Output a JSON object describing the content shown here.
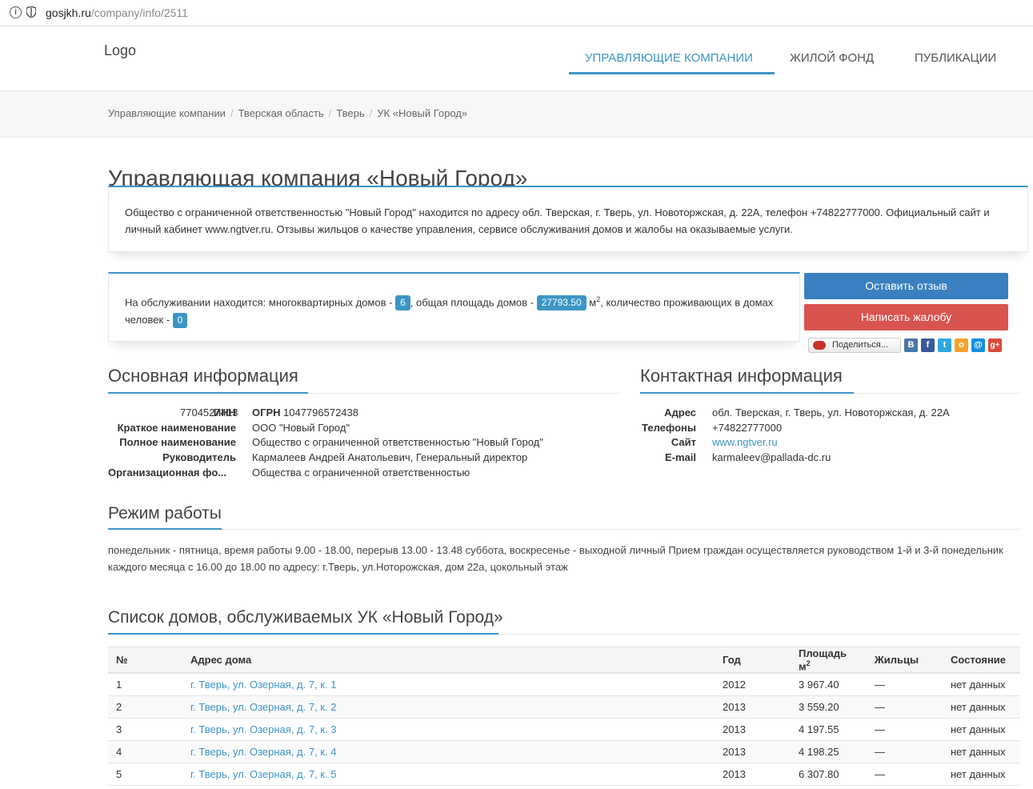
{
  "browser": {
    "url_host": "gosjkh.ru",
    "url_path": "/company/info/2511"
  },
  "header": {
    "logo": "Logo",
    "nav": [
      "УПРАВЛЯЮЩИЕ КОМПАНИИ",
      "ЖИЛОЙ ФОНД",
      "ПУБЛИКАЦИИ"
    ],
    "active_nav": 0
  },
  "breadcrumb": [
    "Управляющие компании",
    "Тверская область",
    "Тверь",
    "УК «Новый Город»"
  ],
  "page_title": "Управляющая компания «Новый Город»",
  "intro": "Общество с ограниченной ответственностью \"Новый Город\" находится по адресу обл. Тверская, г. Тверь, ул. Новоторжская, д. 22А, телефон +74822777000. Официальный сайт и личный кабинет www.ngtver.ru. Отзывы жильцов о качестве управления, сервисе обслуживания домов и жалобы на оказываемые услуги.",
  "stats": {
    "text_1": "На обслуживании находится: многоквартирных домов - ",
    "houses": "6",
    "text_2": ", общая площадь домов - ",
    "area": "27793.50",
    "unit": "м",
    "unit_sup": "2",
    "text_3": ", количество проживающих в домах человек - ",
    "residents": "0"
  },
  "buttons": {
    "review": "Оставить отзыв",
    "complaint": "Написать жалобу",
    "share": "Поделиться..."
  },
  "share_icons": [
    {
      "name": "vk-icon",
      "glyph": "В",
      "color": "#4a76a8"
    },
    {
      "name": "facebook-icon",
      "glyph": "f",
      "color": "#3b5998"
    },
    {
      "name": "twitter-icon",
      "glyph": "t",
      "color": "#2fa7dd"
    },
    {
      "name": "odnoklassniki-icon",
      "glyph": "о",
      "color": "#f4a42c"
    },
    {
      "name": "mailru-icon",
      "glyph": "@",
      "color": "#168de2"
    },
    {
      "name": "googleplus-icon",
      "glyph": "g+",
      "color": "#d74c3c"
    }
  ],
  "main_info": {
    "title": "Основная информация",
    "inn_label": "ИНН",
    "inn": "7704527413",
    "ogrn_label": "ОГРН",
    "ogrn": "1047796572438",
    "short_name_label": "Краткое наименование",
    "short_name": "ООО \"Новый Город\"",
    "full_name_label": "Полное наименование",
    "full_name": "Общество с ограниченной ответственностью \"Новый Город\"",
    "head_label": "Руководитель",
    "head": "Кармалеев Андрей Анатольевич, Генеральный директор",
    "org_form_label": "Организационная фо...",
    "org_form": "Общества с ограниченной ответственностью"
  },
  "contact_info": {
    "title": "Контактная информация",
    "address_label": "Адрес",
    "address": "обл. Тверская, г. Тверь, ул. Новоторжская, д. 22А",
    "phones_label": "Телефоны",
    "phones": "+74822777000",
    "site_label": "Сайт",
    "site": "www.ngtver.ru",
    "email_label": "E-mail",
    "email": "karmaleev@pallada-dc.ru"
  },
  "work_mode": {
    "title": "Режим работы",
    "text": "понедельник - пятница, время работы 9.00 - 18.00, перерыв 13.00 - 13.48 суббота, воскресенье - выходной личный Прием граждан осуществляется руководством 1-й и 3-й понедельник каждого месяца с 16.00 до 18.00 по адресу: г.Тверь, ул.Ноторожская, дом 22а, цокольный этаж"
  },
  "houses": {
    "title": "Список домов, обслуживаемых УК «Новый Город»",
    "columns": [
      "№",
      "Адрес дома",
      "Год",
      "Площадь м",
      "Жильцы",
      "Состояние"
    ],
    "area_sup": "2",
    "rows": [
      {
        "n": "1",
        "address": "г. Тверь, ул. Озерная, д. 7, к. 1",
        "year": "2012",
        "area": "3 967.40",
        "residents": "—",
        "status": "нет данных"
      },
      {
        "n": "2",
        "address": "г. Тверь, ул. Озерная, д. 7, к. 2",
        "year": "2013",
        "area": "3 559.20",
        "residents": "—",
        "status": "нет данных"
      },
      {
        "n": "3",
        "address": "г. Тверь, ул. Озерная, д. 7, к. 3",
        "year": "2013",
        "area": "4 197.55",
        "residents": "—",
        "status": "нет данных"
      },
      {
        "n": "4",
        "address": "г. Тверь, ул. Озерная, д. 7, к. 4",
        "year": "2013",
        "area": "4 198.25",
        "residents": "—",
        "status": "нет данных"
      },
      {
        "n": "5",
        "address": "г. Тверь, ул. Озерная, д. 7, к. 5",
        "year": "2013",
        "area": "6 307.80",
        "residents": "—",
        "status": "нет данных"
      }
    ]
  }
}
